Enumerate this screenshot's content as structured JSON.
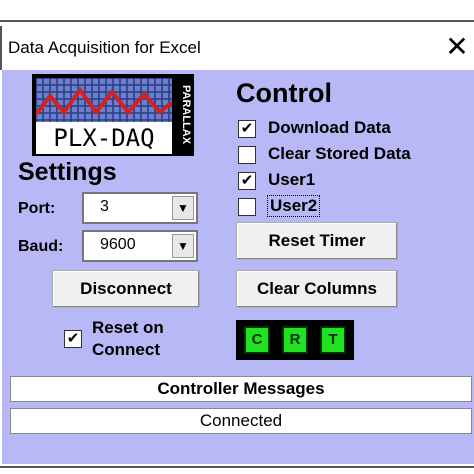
{
  "window": {
    "title": "Data Acquisition for Excel",
    "close_symbol": "✕"
  },
  "logo": {
    "text": "PLX-DAQ",
    "side_text": "PARALLAX"
  },
  "settings": {
    "title": "Settings",
    "port_label": "Port:",
    "port_value": "3",
    "baud_label": "Baud:",
    "baud_value": "9600",
    "disconnect_label": "Disconnect",
    "reset_on_connect_label_1": "Reset on",
    "reset_on_connect_label_2": "Connect",
    "reset_on_connect_checked": true
  },
  "control": {
    "title": "Control",
    "checkboxes": [
      {
        "label": "Download Data",
        "checked": true
      },
      {
        "label": "Clear Stored Data",
        "checked": false
      },
      {
        "label": "User1",
        "checked": true
      },
      {
        "label": "User2",
        "checked": false
      }
    ],
    "reset_timer_label": "Reset Timer",
    "clear_columns_label": "Clear Columns",
    "indicators": [
      "C",
      "R",
      "T"
    ]
  },
  "messages": {
    "title": "Controller Messages",
    "status": "Connected"
  },
  "colors": {
    "client_bg": "#b8b8f6",
    "indicator_green": "#22e022"
  },
  "icons": {
    "check": "✔",
    "dropdown": "▼"
  }
}
